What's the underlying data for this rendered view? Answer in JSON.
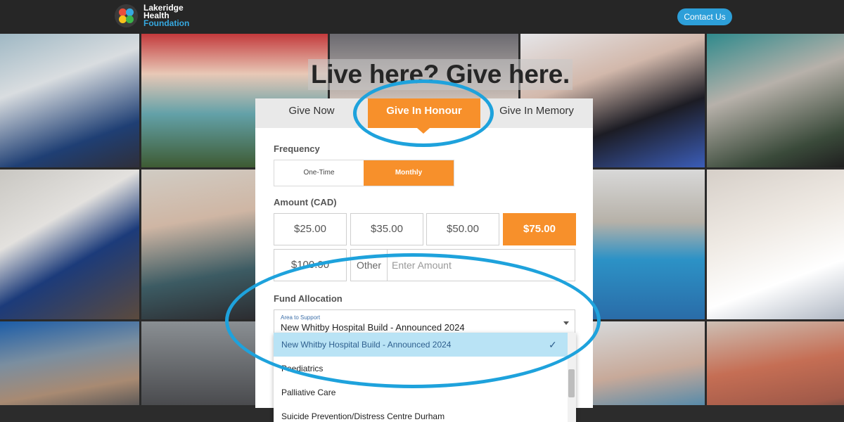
{
  "header": {
    "logo": {
      "line1": "Lakeridge",
      "line2": "Health",
      "line3": "Foundation"
    },
    "contact_label": "Contact Us"
  },
  "headline": "Live here? Give here.",
  "form": {
    "tabs": [
      {
        "label": "Give Now",
        "active": false
      },
      {
        "label": "Give In Honour",
        "active": true
      },
      {
        "label": "Give In Memory",
        "active": false
      }
    ],
    "frequency": {
      "label": "Frequency",
      "options": [
        {
          "label": "One-Time",
          "active": false
        },
        {
          "label": "Monthly",
          "active": true
        }
      ]
    },
    "amount": {
      "label": "Amount (CAD)",
      "options": [
        {
          "label": "$25.00",
          "active": false
        },
        {
          "label": "$35.00",
          "active": false
        },
        {
          "label": "$50.00",
          "active": false
        },
        {
          "label": "$75.00",
          "active": true
        },
        {
          "label": "$100.00",
          "active": false
        }
      ],
      "other_label": "Other",
      "other_placeholder": "Enter Amount"
    },
    "fund": {
      "label": "Fund Allocation",
      "select_label": "Area to Support",
      "selected_value": "New Whitby Hospital Build - Announced 2024",
      "options": [
        "New Whitby Hospital Build - Announced 2024",
        "Paediatrics",
        "Palliative Care",
        "Suicide Prevention/Distress Centre Durham"
      ]
    }
  },
  "colors": {
    "accent_orange": "#f7902b",
    "button_blue": "#2d9fd9",
    "annotation_blue": "#1ea2dc",
    "selected_row": "#b9e3f5"
  }
}
